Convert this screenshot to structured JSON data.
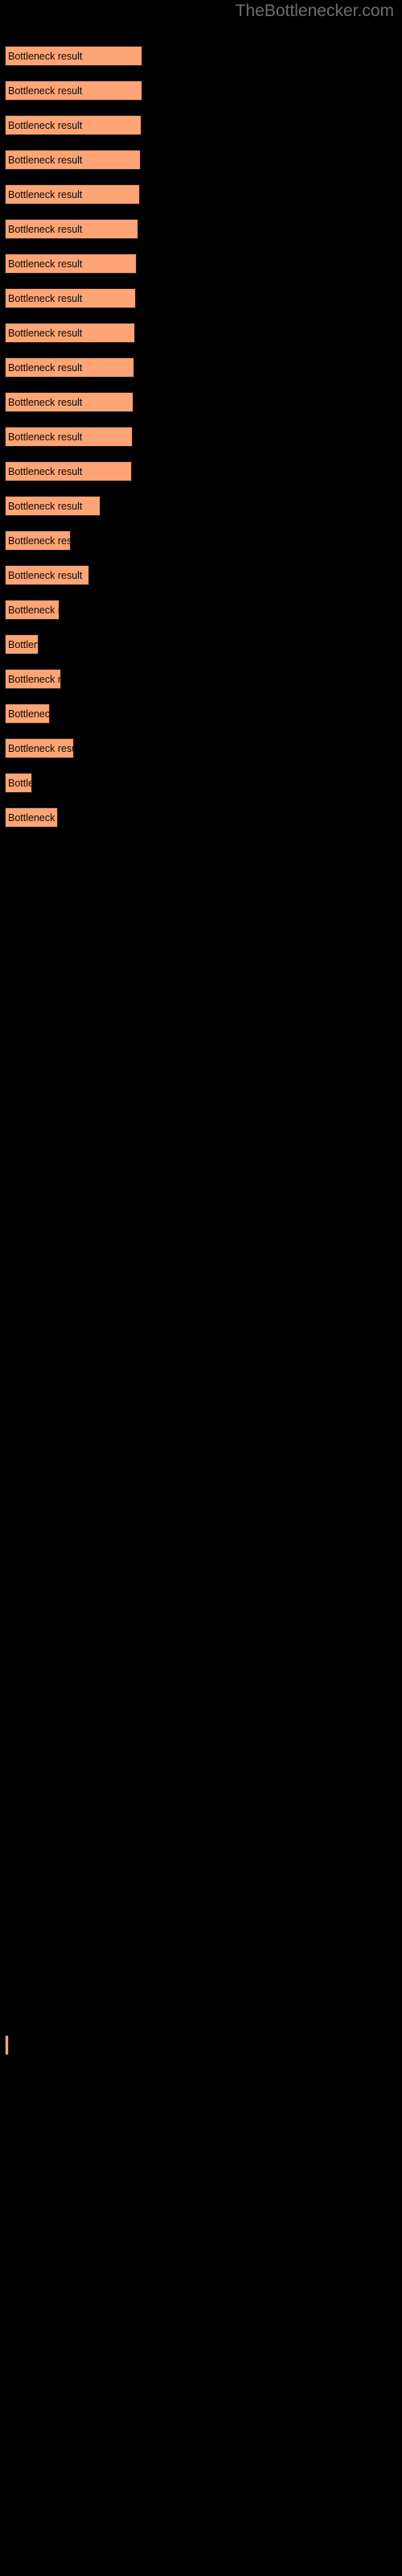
{
  "watermark": {
    "text": "TheBottlenecker.com",
    "color": "#6e6e6e"
  },
  "colors": {
    "background": "#000000",
    "bar_fill": "#FFA474",
    "bar_border": "#231f20",
    "bar_label": "#0a0a0a",
    "watermark": "#6e6e6e"
  },
  "bar_label_text": "Bottleneck result",
  "chart_data": {
    "type": "bar",
    "orientation": "horizontal",
    "title": "",
    "subtitle": "",
    "xlabel": "",
    "ylabel": "",
    "grid": false,
    "legend": null,
    "categories": [
      "Bottleneck result",
      "Bottleneck result",
      "Bottleneck result",
      "Bottleneck result",
      "Bottleneck result",
      "Bottleneck result",
      "Bottleneck result",
      "Bottleneck result",
      "Bottleneck result",
      "Bottleneck result",
      "Bottleneck result",
      "Bottleneck result",
      "Bottleneck result",
      "Bottleneck result",
      "Bottleneck result",
      "Bottleneck result",
      "Bottleneck result",
      "Bottleneck result",
      "Bottleneck result",
      "Bottleneck result",
      "Bottleneck result",
      "Bottleneck result",
      "Bottleneck result",
      "Bottleneck result",
      "Bottleneck result",
      "Bottleneck result"
    ],
    "values": [
      171,
      171,
      170,
      169,
      168,
      166,
      164,
      163,
      162,
      161,
      160,
      159,
      158,
      119,
      82,
      105,
      68,
      42,
      70,
      56,
      86,
      34,
      66,
      0,
      0,
      5
    ],
    "xlim": [
      0,
      500
    ],
    "bars": [
      {
        "index": 1,
        "y": 57,
        "width": 171,
        "label": "Bottleneck result"
      },
      {
        "index": 2,
        "y": 100,
        "width": 171,
        "label": "Bottleneck result"
      },
      {
        "index": 3,
        "y": 143,
        "width": 170,
        "label": "Bottleneck result"
      },
      {
        "index": 4,
        "y": 186,
        "width": 169,
        "label": "Bottleneck result"
      },
      {
        "index": 5,
        "y": 229,
        "width": 168,
        "label": "Bottleneck result"
      },
      {
        "index": 6,
        "y": 272,
        "width": 166,
        "label": "Bottleneck result"
      },
      {
        "index": 7,
        "y": 315,
        "width": 164,
        "label": "Bottleneck result"
      },
      {
        "index": 8,
        "y": 358,
        "width": 163,
        "label": "Bottleneck result"
      },
      {
        "index": 9,
        "y": 401,
        "width": 162,
        "label": "Bottleneck result"
      },
      {
        "index": 10,
        "y": 444,
        "width": 161,
        "label": "Bottleneck result"
      },
      {
        "index": 11,
        "y": 487,
        "width": 160,
        "label": "Bottleneck result"
      },
      {
        "index": 12,
        "y": 530,
        "width": 159,
        "label": "Bottleneck result"
      },
      {
        "index": 13,
        "y": 573,
        "width": 158,
        "label": "Bottleneck result"
      },
      {
        "index": 14,
        "y": 616,
        "width": 119,
        "label": "Bottleneck result"
      },
      {
        "index": 15,
        "y": 659,
        "width": 82,
        "label": "Bottleneck result"
      },
      {
        "index": 16,
        "y": 702,
        "width": 105,
        "label": "Bottleneck result"
      },
      {
        "index": 17,
        "y": 745,
        "width": 68,
        "label": "Bottleneck result"
      },
      {
        "index": 18,
        "y": 788,
        "width": 42,
        "label": "Bottleneck result"
      },
      {
        "index": 19,
        "y": 831,
        "width": 70,
        "label": "Bottleneck result"
      },
      {
        "index": 20,
        "y": 874,
        "width": 56,
        "label": "Bottleneck result"
      },
      {
        "index": 21,
        "y": 917,
        "width": 86,
        "label": "Bottleneck result"
      },
      {
        "index": 22,
        "y": 960,
        "width": 34,
        "label": "Bottleneck result"
      },
      {
        "index": 23,
        "y": 1003,
        "width": 66,
        "label": "Bottleneck result"
      },
      {
        "index": 24,
        "y": 2528,
        "width": 5,
        "label": "Bottleneck result"
      }
    ]
  }
}
